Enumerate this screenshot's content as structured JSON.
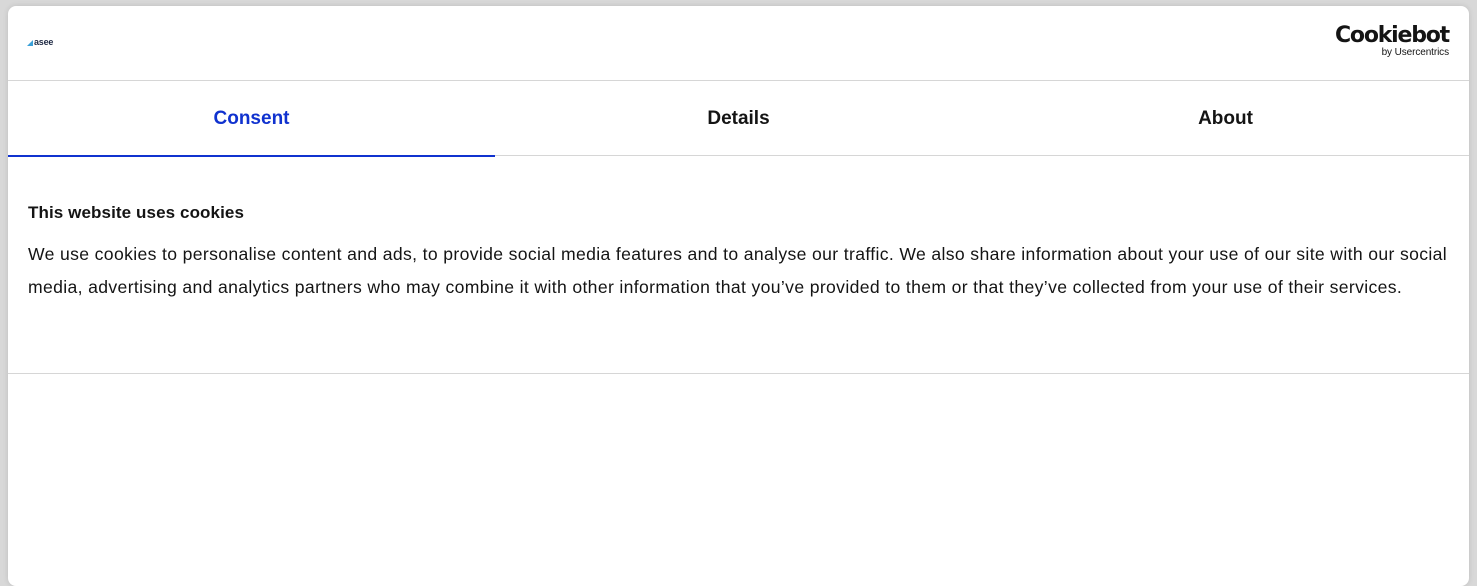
{
  "header": {
    "brand_logo": "asee",
    "cookiebot_name": "Cookiebot",
    "cookiebot_sub": "by Usercentrics"
  },
  "tabs": [
    {
      "label": "Consent",
      "active": true
    },
    {
      "label": "Details",
      "active": false
    },
    {
      "label": "About",
      "active": false
    }
  ],
  "content": {
    "title": "This website uses cookies",
    "body": "We use cookies to personalise content and ads, to provide social media features and to analyse our traffic. We also share information about your use of our site with our social media, advertising and analytics partners who may combine it with other information that you’ve provided to them or that they’ve collected from your use of their services."
  },
  "colors": {
    "accent": "#1032cf",
    "text": "#141414",
    "divider": "#d6d6d6",
    "brand_mark": "#3aa0d8"
  }
}
